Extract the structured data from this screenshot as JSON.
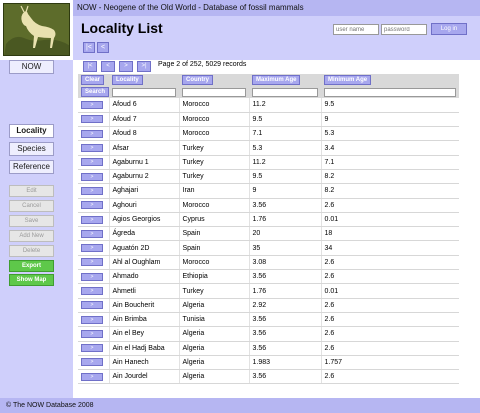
{
  "header": {
    "top_title": "NOW - Neogene of the Old World - Database of fossil mammals",
    "page_title": "Locality List",
    "nav_first": "|<",
    "nav_prev": "<",
    "login_user_placeholder": "user name",
    "login_pass_placeholder": "password",
    "login_button": "Log in"
  },
  "sidebar": {
    "now": "NOW",
    "locality": "Locality",
    "species": "Species",
    "reference": "Reference",
    "edit": "Edit",
    "cancel": "Cancel",
    "save": "Save",
    "add_new": "Add New",
    "delete": "Delete",
    "export": "Export",
    "show_map": "Show Map"
  },
  "pager": {
    "first": "|<",
    "prev": "<",
    "next": ">",
    "last": ">|",
    "info": "Page 2 of 252, 5029 records"
  },
  "table": {
    "clear": "Clear",
    "search": "Search",
    "columns": [
      "Locality",
      "Country",
      "Maximum Age",
      "Minimum Age"
    ],
    "row_button": ">",
    "rows": [
      [
        "Afoud 6",
        "Morocco",
        "11.2",
        "9.5"
      ],
      [
        "Afoud 7",
        "Morocco",
        "9.5",
        "9"
      ],
      [
        "Afoud 8",
        "Morocco",
        "7.1",
        "5.3"
      ],
      [
        "Afsar",
        "Turkey",
        "5.3",
        "3.4"
      ],
      [
        "Agaburnu 1",
        "Turkey",
        "11.2",
        "7.1"
      ],
      [
        "Agaburnu 2",
        "Turkey",
        "9.5",
        "8.2"
      ],
      [
        "Aghajari",
        "Iran",
        "9",
        "8.2"
      ],
      [
        "Aghouri",
        "Morocco",
        "3.56",
        "2.6"
      ],
      [
        "Agios Georgios",
        "Cyprus",
        "1.76",
        "0.01"
      ],
      [
        "Ágreda",
        "Spain",
        "20",
        "18"
      ],
      [
        "Aguatón 2D",
        "Spain",
        "35",
        "34"
      ],
      [
        "Ahl al Oughlam",
        "Morocco",
        "3.08",
        "2.6"
      ],
      [
        "Ahmado",
        "Ethiopia",
        "3.56",
        "2.6"
      ],
      [
        "Ahmetli",
        "Turkey",
        "1.76",
        "0.01"
      ],
      [
        "Ain Boucherit",
        "Algeria",
        "2.92",
        "2.6"
      ],
      [
        "Ain Brimba",
        "Tunisia",
        "3.56",
        "2.6"
      ],
      [
        "Ain el Bey",
        "Algeria",
        "3.56",
        "2.6"
      ],
      [
        "Ain el Hadj Baba",
        "Algeria",
        "3.56",
        "2.6"
      ],
      [
        "Ain Hanech",
        "Algeria",
        "1.983",
        "1.757"
      ],
      [
        "Ain Jourdel",
        "Algeria",
        "3.56",
        "2.6"
      ]
    ]
  },
  "footer": "© The NOW Database 2008",
  "colors": {
    "header_bar": "#b6b6f2",
    "sidebar_bg": "#cfcffb",
    "button_blue": "#a7a7ee",
    "export_green": "#5ec84a"
  },
  "icons": {
    "logo": "deer-silhouette-logo"
  }
}
